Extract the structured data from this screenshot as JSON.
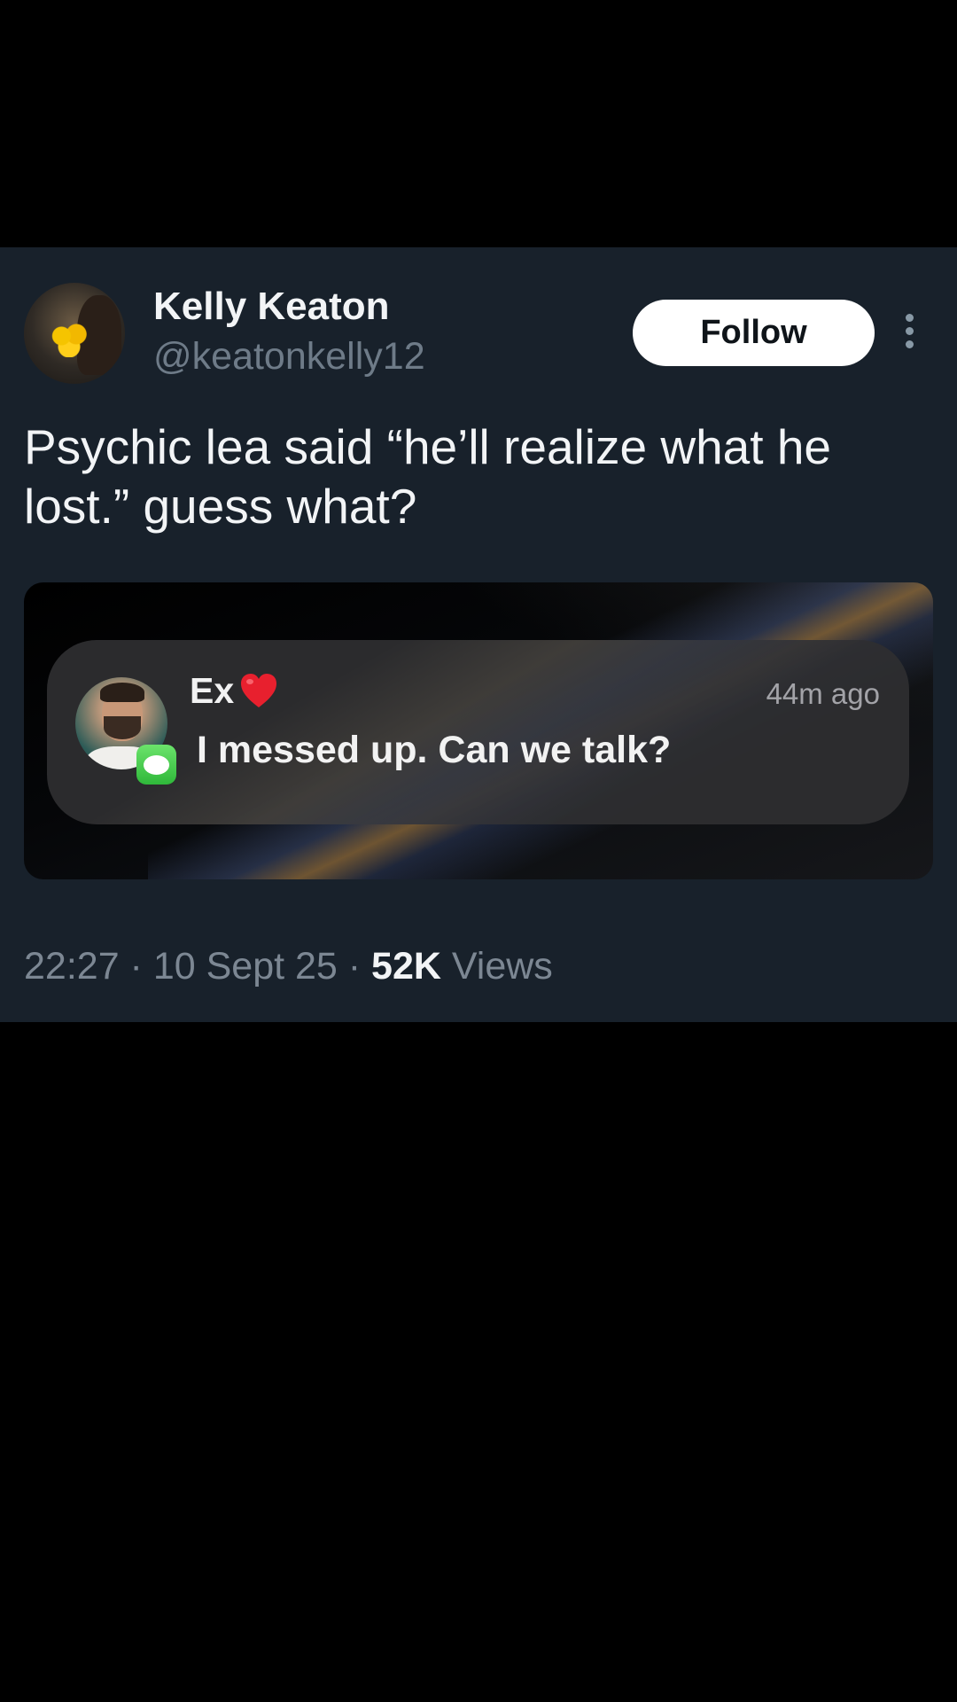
{
  "post": {
    "author_name": "Kelly Keaton",
    "author_handle": "@keatonkelly12",
    "follow_label": "Follow",
    "text": "Psychic lea said “he’ll realize what he lost.” guess what?",
    "timestamp": "22:27 · 10 Sept 25 · ",
    "views_count": "52K",
    "views_label": " Views"
  },
  "notification": {
    "sender": "Ex",
    "time": "44m ago",
    "message": "I messed up. Can we talk?",
    "app_icon": "messages-icon",
    "emoji": "red-heart"
  },
  "colors": {
    "background": "#000000",
    "card": "#18212b",
    "muted_text": "#6e7b88",
    "follow_bg": "#ffffff"
  }
}
